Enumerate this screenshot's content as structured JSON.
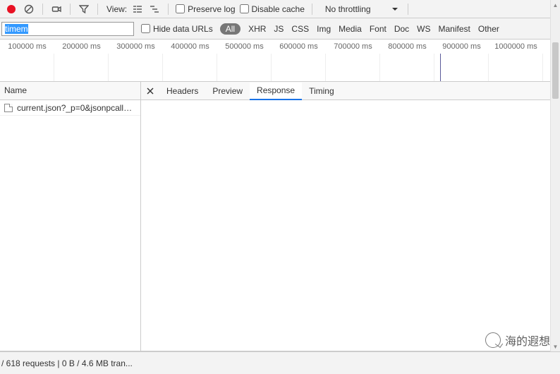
{
  "toolbar": {
    "view_label": "View:",
    "preserve_log": "Preserve log",
    "disable_cache": "Disable cache",
    "throttling": "No throttling"
  },
  "filter": {
    "input_value": "timem",
    "hide_data_urls": "Hide data URLs",
    "types": {
      "all": "All",
      "xhr": "XHR",
      "js": "JS",
      "css": "CSS",
      "img": "Img",
      "media": "Media",
      "font": "Font",
      "doc": "Doc",
      "ws": "WS",
      "manifest": "Manifest",
      "other": "Other"
    }
  },
  "timeline": {
    "labels": [
      "100000 ms",
      "200000 ms",
      "300000 ms",
      "400000 ms",
      "500000 ms",
      "600000 ms",
      "700000 ms",
      "800000 ms",
      "900000 ms",
      "1000000 ms"
    ],
    "cursor_ms": 860000
  },
  "requests": {
    "col_name": "Name",
    "items": [
      {
        "name": "current.json?_p=0&jsonpcallba..."
      }
    ]
  },
  "detail_tabs": {
    "headers": "Headers",
    "preview": "Preview",
    "response": "Response",
    "timing": "Timing"
  },
  "status": {
    "text": "/ 618 requests  |  0 B / 4.6 MB tran..."
  },
  "watermark": "海的遐想"
}
